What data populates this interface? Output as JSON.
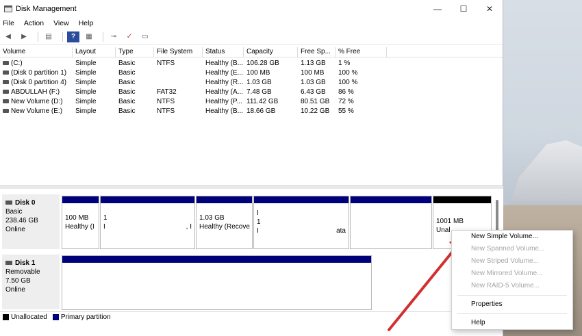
{
  "window": {
    "title": "Disk Management",
    "minimize": "—",
    "maximize": "☐",
    "close": "✕"
  },
  "menu": [
    "File",
    "Action",
    "View",
    "Help"
  ],
  "columns": [
    "Volume",
    "Layout",
    "Type",
    "File System",
    "Status",
    "Capacity",
    "Free Sp...",
    "% Free"
  ],
  "volumes": [
    [
      "(C:)",
      "Simple",
      "Basic",
      "NTFS",
      "Healthy (B...",
      "106.28 GB",
      "1.13 GB",
      "1 %"
    ],
    [
      "(Disk 0 partition 1)",
      "Simple",
      "Basic",
      "",
      "Healthy (E...",
      "100 MB",
      "100 MB",
      "100 %"
    ],
    [
      "(Disk 0 partition 4)",
      "Simple",
      "Basic",
      "",
      "Healthy (R...",
      "1.03 GB",
      "1.03 GB",
      "100 %"
    ],
    [
      "ABDULLAH (F:)",
      "Simple",
      "Basic",
      "FAT32",
      "Healthy (A...",
      "7.48 GB",
      "6.43 GB",
      "86 %"
    ],
    [
      "New Volume (D:)",
      "Simple",
      "Basic",
      "NTFS",
      "Healthy (P...",
      "111.42 GB",
      "80.51 GB",
      "72 %"
    ],
    [
      "New Volume (E:)",
      "Simple",
      "Basic",
      "NTFS",
      "Healthy (B...",
      "18.66 GB",
      "10.22 GB",
      "55 %"
    ]
  ],
  "disk0": {
    "name": "Disk 0",
    "type": "Basic",
    "size": "238.46 GB",
    "status": "Online",
    "p1": {
      "line1": "100 MB",
      "line2": "Healthy (I"
    },
    "p2": {
      "line1": "1",
      "line2": "I",
      "line3": ", I"
    },
    "p3": {
      "line1": "1.03 GB",
      "line2": "Healthy (Recove"
    },
    "p4": {
      "line1": "I",
      "line2": "1",
      "line3": "I",
      "line4": "ata"
    },
    "p6": {
      "line1": "1001 MB",
      "line2": "Unal"
    }
  },
  "disk1": {
    "name": "Disk 1",
    "type": "Removable",
    "size": "7.50 GB",
    "status": "Online"
  },
  "legend": {
    "unallocated": "Unallocated",
    "primary": "Primary partition",
    "unallocated_color": "#000000",
    "primary_color": "#00007a"
  },
  "context_menu": {
    "new_simple": "New Simple Volume...",
    "new_spanned": "New Spanned Volume...",
    "new_striped": "New Striped Volume...",
    "new_mirrored": "New Mirrored Volume...",
    "new_raid5": "New RAID-5 Volume...",
    "properties": "Properties",
    "help": "Help"
  },
  "annotation_color": "#d32f2f"
}
